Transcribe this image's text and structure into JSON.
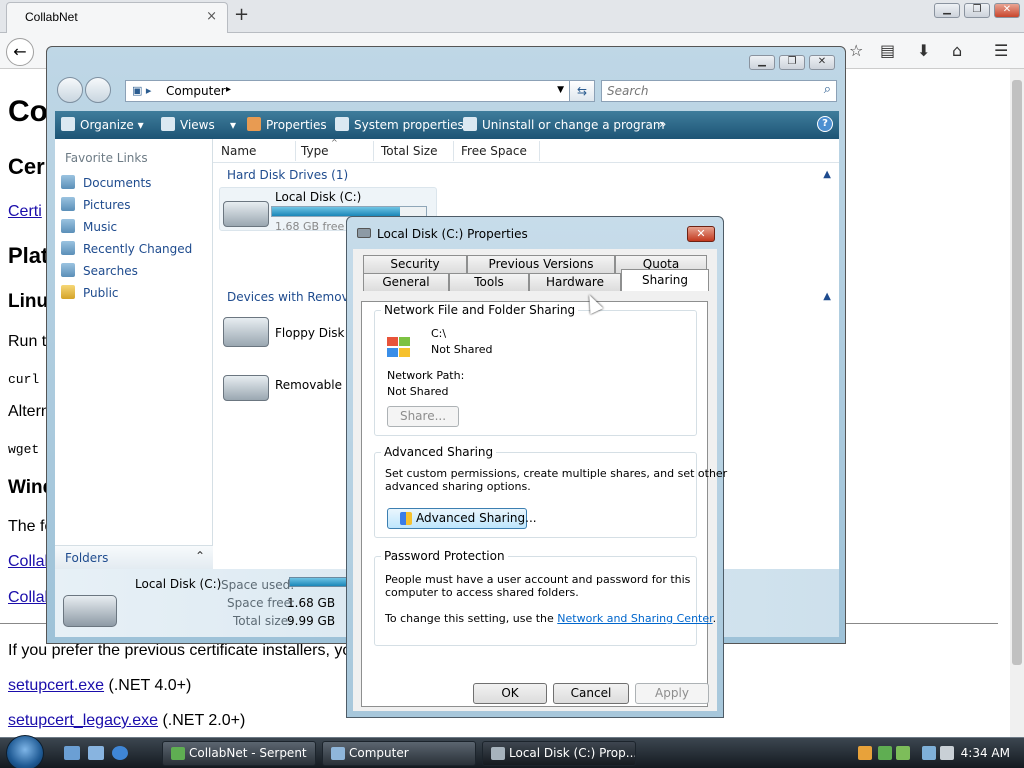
{
  "browser": {
    "tab_title": "CollabNet",
    "tab_close": "×",
    "new_tab": "+",
    "page": {
      "h1": "Co",
      "h2_a": "Cer",
      "link_a": "Certi",
      "h2_b": "Plat",
      "h3_linux": "Linu",
      "p_run": "Run th",
      "code_curl": "curl",
      "p_alt": "Altern",
      "code_wget": "wget",
      "h3_win": "Wind",
      "p_the": "The fo",
      "link_b": "Collab",
      "link_c": "Collab",
      "p_prefer": "If you prefer the previous certificate installers, you",
      "link_setup": "setupcert.exe",
      "setup_note": " (.NET 4.0+)",
      "link_legacy": "setupcert_legacy.exe",
      "legacy_note": " (.NET 2.0+)"
    }
  },
  "explorer": {
    "address": "Computer",
    "search_placeholder": "Search",
    "toolbar": {
      "organize": "Organize",
      "views": "Views",
      "properties": "Properties",
      "system_properties": "System properties",
      "uninstall": "Uninstall or change a program",
      "more": "»",
      "help": "?"
    },
    "nav": {
      "title": "Favorite Links",
      "items": [
        "Documents",
        "Pictures",
        "Music",
        "Recently Changed",
        "Searches",
        "Public"
      ],
      "folders": "Folders"
    },
    "columns": [
      "Name",
      "Type",
      "Total Size",
      "Free Space"
    ],
    "groups": {
      "hard_disks": "Hard Disk Drives (1)",
      "removable": "Devices with Removable"
    },
    "drives": {
      "local_name": "Local Disk (C:)",
      "local_free": "1.68 GB free o",
      "local_fill_fraction": 0.83,
      "floppy": "Floppy Disk D",
      "removable": "Removable Di"
    },
    "details": {
      "name": "Local Disk (C:)",
      "space_used_label": "Space used:",
      "space_free_label": "Space free:",
      "space_free": "1.68 GB",
      "total_size_label": "Total size:",
      "total_size": "9.99 GB"
    }
  },
  "properties": {
    "title": "Local Disk (C:) Properties",
    "close": "✕",
    "tabs_row1": [
      "Security",
      "Previous Versions",
      "Quota"
    ],
    "tabs_row2": [
      "General",
      "Tools",
      "Hardware",
      "Sharing"
    ],
    "active_tab": "Sharing",
    "network_sharing": {
      "title": "Network File and Folder Sharing",
      "path": "C:\\",
      "status": "Not Shared",
      "network_path_label": "Network Path:",
      "network_path": "Not Shared",
      "share_button": "Share..."
    },
    "advanced": {
      "title": "Advanced Sharing",
      "desc_line1": "Set custom permissions, create multiple shares, and set other",
      "desc_line2": "advanced sharing options.",
      "button": "Advanced Sharing..."
    },
    "password": {
      "title": "Password Protection",
      "line1": "People must have a user account and password for this",
      "line2": "computer to access shared folders.",
      "line3_prefix": "To change this setting, use the ",
      "link": "Network and Sharing Center",
      "line3_suffix": "."
    },
    "buttons": {
      "ok": "OK",
      "cancel": "Cancel",
      "apply": "Apply"
    }
  },
  "taskbar": {
    "items": [
      "CollabNet - Serpent",
      "Computer",
      "Local Disk (C:) Prop..."
    ],
    "clock": "4:34 AM"
  }
}
